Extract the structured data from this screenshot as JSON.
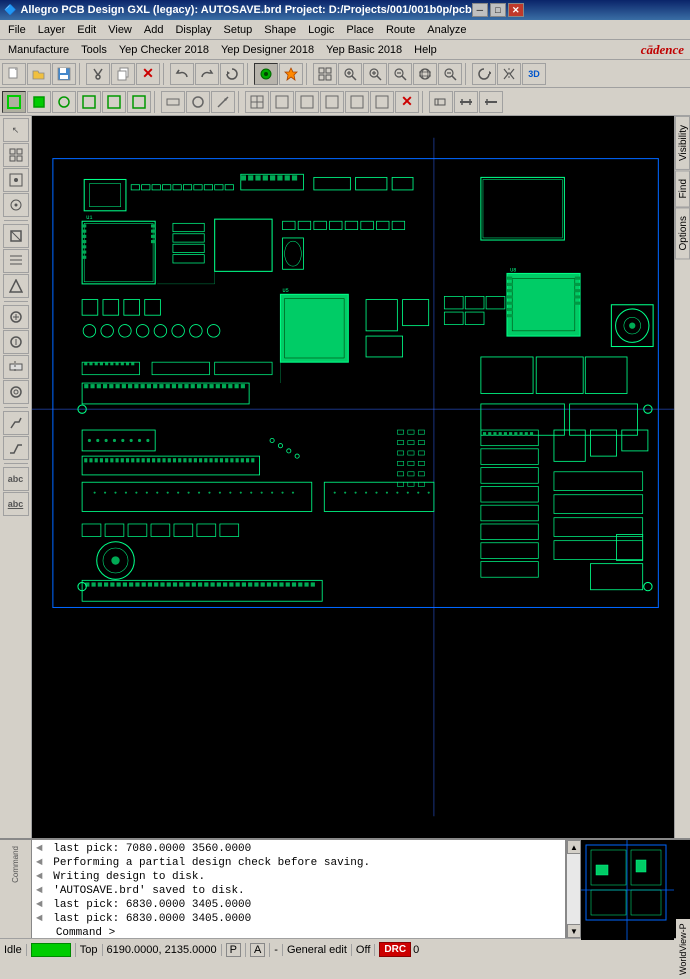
{
  "titlebar": {
    "text": "Allegro PCB Design GXL (legacy): AUTOSAVE.brd  Project: D:/Projects/001/001b0p/pcb",
    "minimize": "─",
    "maximize": "□",
    "close": "✕"
  },
  "menubar1": {
    "items": [
      "File",
      "Layer",
      "Edit",
      "View",
      "Add",
      "Display",
      "Setup",
      "Shape",
      "Logic",
      "Place",
      "Route",
      "Analyze"
    ]
  },
  "menubar2": {
    "items": [
      "Manufacture",
      "Tools",
      "Yep Checker 2018",
      "Yep Designer 2018",
      "Yep Basic 2018",
      "Help"
    ],
    "logo": "cādence"
  },
  "toolbar1": {
    "buttons": [
      "📁",
      "📂",
      "💾",
      "✂",
      "📋",
      "🗑",
      "↩",
      "↪",
      "⟳",
      "📌",
      "🎯",
      "▦",
      "⊞",
      "🔍",
      "🔎",
      "🔍",
      "🔎",
      "🔍",
      "🔎",
      "↔",
      "🔄",
      "🔃",
      "🌐"
    ]
  },
  "toolbar2": {
    "buttons": [
      "□",
      "□",
      "○",
      "□",
      "□",
      "□",
      "□",
      "◻",
      "○",
      "→",
      "□",
      "□",
      "□",
      "□",
      "☓",
      "□",
      "⊞",
      "⊟"
    ]
  },
  "left_toolbar": {
    "buttons": [
      "↖",
      "⊞",
      "⊡",
      "⊙",
      "◎",
      "▣",
      "▤",
      "—",
      "⊕",
      "⊗",
      "⊘",
      "⊙",
      "⊛",
      "—",
      "⊜",
      "⊝",
      "⊞",
      "⊟",
      "—",
      "abc",
      "abc"
    ]
  },
  "right_panel": {
    "tabs": [
      "Visibility",
      "Find",
      "Options"
    ]
  },
  "command_log": {
    "lines": [
      {
        "arrow": "◄",
        "text": "last pick:  7080.0000 3560.0000"
      },
      {
        "arrow": "◄",
        "text": "Performing a partial design check before saving."
      },
      {
        "arrow": "◄",
        "text": "Writing design to disk."
      },
      {
        "arrow": "◄",
        "text": "'AUTOSAVE.brd' saved to disk."
      },
      {
        "arrow": "◄",
        "text": "last pick:  6830.0000 3405.0000"
      },
      {
        "arrow": "◄",
        "text": "last pick:  6830.0000 3405.0000"
      },
      {
        "arrow": "",
        "text": "Command >"
      }
    ]
  },
  "status_bar": {
    "idle": "Idle",
    "layer": "Top",
    "coordinates": "6190.0000, 2135.0000",
    "p_indicator": "P",
    "a_indicator": "A",
    "dash": "-",
    "mode": "General edit",
    "off_label": "Off",
    "drc_label": "DRC",
    "counter": "0"
  }
}
